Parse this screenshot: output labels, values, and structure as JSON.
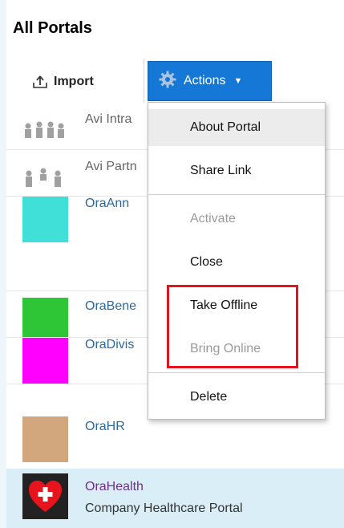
{
  "page": {
    "title": "All Portals"
  },
  "toolbar": {
    "import_label": "Import",
    "actions_label": "Actions",
    "actions_caret": "▼"
  },
  "portals": [
    {
      "name": "Avi Intra",
      "style": "gray",
      "icon": "people-group-icon"
    },
    {
      "name": "Avi Partn",
      "style": "gray",
      "icon": "people-partners-icon"
    },
    {
      "name": "OraAnn",
      "color": "#40e0d8"
    },
    {
      "name": "OraBene",
      "color": "#2ec537"
    },
    {
      "name": "OraDivis",
      "color": "#ff00ff"
    },
    {
      "name": "OraHR",
      "color": "#d2a77e"
    },
    {
      "name": "OraHealth",
      "description": "Company Healthcare Portal",
      "icon": "heart-cross-icon",
      "selected": true
    }
  ],
  "actions_menu": [
    {
      "label": "About Portal",
      "enabled": true,
      "hover": true
    },
    {
      "label": "Share Link",
      "enabled": true
    },
    {
      "label": "Activate",
      "enabled": false
    },
    {
      "label": "Close",
      "enabled": true
    },
    {
      "label": "Take Offline",
      "enabled": true
    },
    {
      "label": "Bring Online",
      "enabled": false
    },
    {
      "label": "Delete",
      "enabled": true
    }
  ],
  "colors": {
    "accent": "#1577d6",
    "highlight": "#e3141c",
    "selected_row": "#d9eef7",
    "link": "#2a6a9e"
  }
}
